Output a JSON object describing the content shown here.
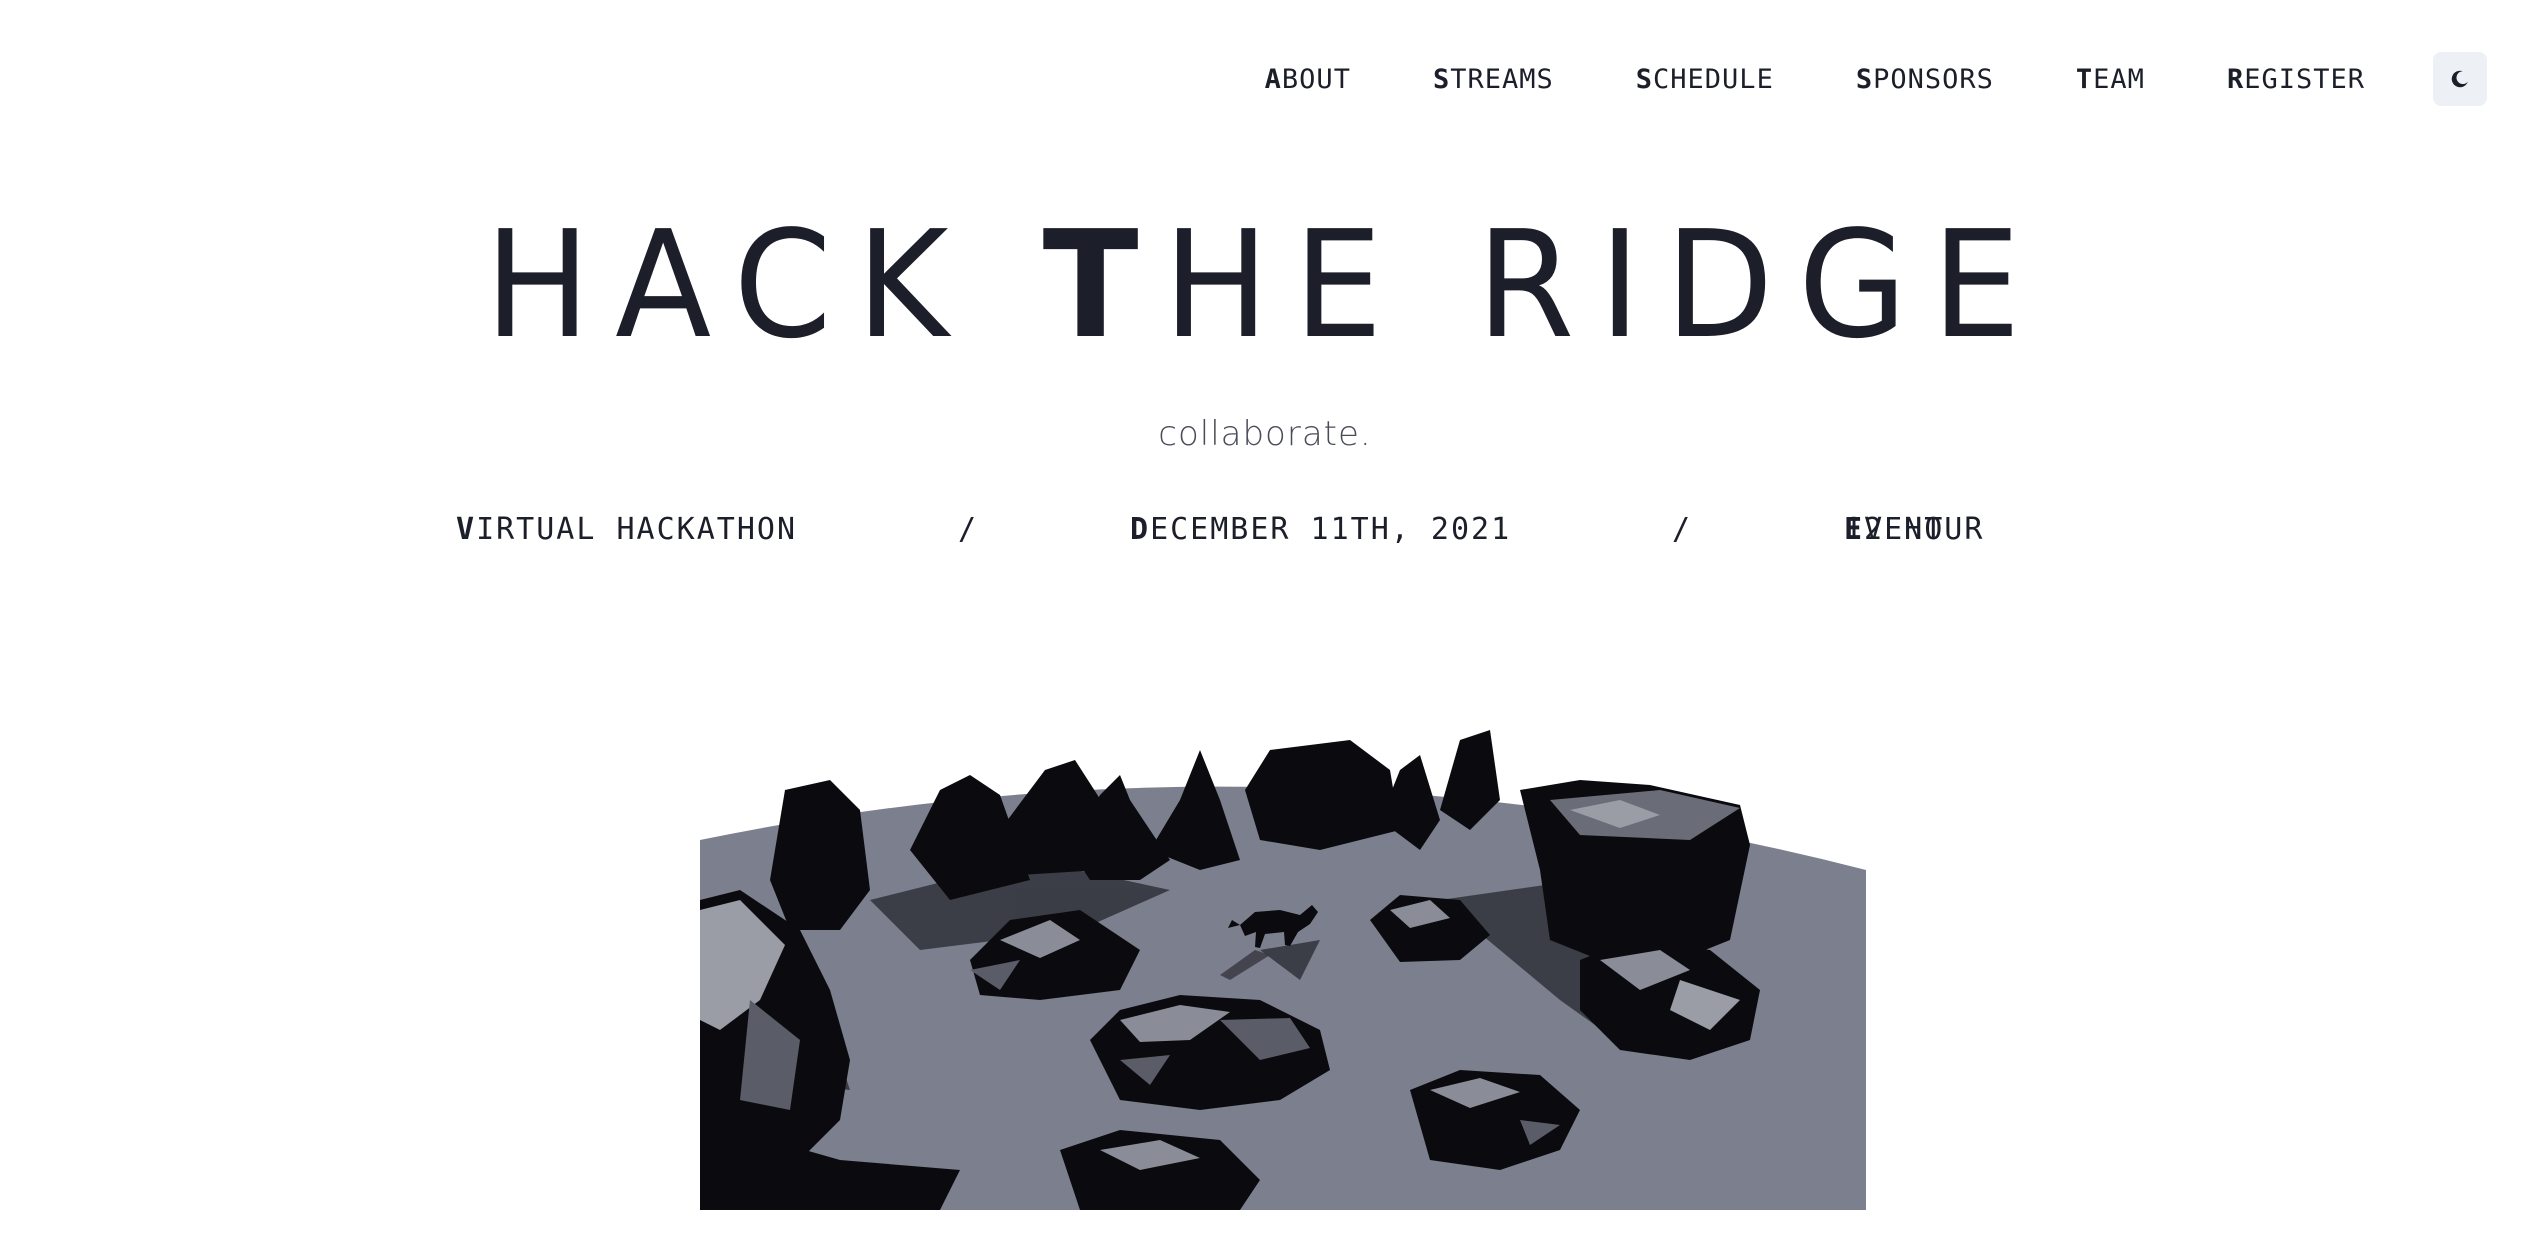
{
  "nav": {
    "items": [
      {
        "first": "A",
        "rest": "BOUT"
      },
      {
        "first": "S",
        "rest": "TREAMS"
      },
      {
        "first": "S",
        "rest": "CHEDULE"
      },
      {
        "first": "S",
        "rest": "PONSORS"
      },
      {
        "first": "T",
        "rest": "EAM"
      },
      {
        "first": "R",
        "rest": "EGISTER"
      }
    ],
    "theme_toggle_icon": "moon-icon"
  },
  "hero": {
    "title_parts": [
      "HACK ",
      "T",
      "HE ",
      "R",
      "IDGE"
    ],
    "tagline": "collaborate."
  },
  "details": {
    "type_first": "V",
    "type_rest": "IRTUAL HACKATHON",
    "sep1": "/",
    "date_first": "D",
    "date_rest": "ECEMBER 11TH, 2021",
    "sep2": "/",
    "duration_pre": "12 HOUR ",
    "duration_first": "E",
    "duration_rest": "VENT"
  },
  "scene": {
    "icon": "low-poly-wolf-landscape-illustration",
    "ground_color": "#7c7f8d",
    "rock_color": "#0b0b0f"
  }
}
